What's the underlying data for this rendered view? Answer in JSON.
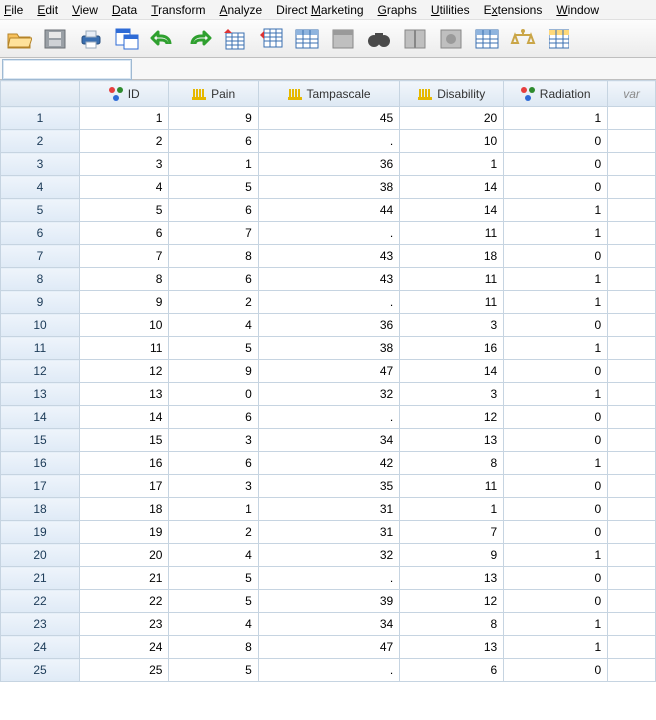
{
  "menu": {
    "file": "File",
    "edit": "Edit",
    "view": "View",
    "data": "Data",
    "transform": "Transform",
    "analyze": "Analyze",
    "direct_marketing": "Direct Marketing",
    "graphs": "Graphs",
    "utilities": "Utilities",
    "extensions": "Extensions",
    "window": "Window"
  },
  "toolbar_icons": [
    "open",
    "save",
    "print",
    "recall-dialog",
    "undo",
    "redo",
    "goto-case",
    "variables",
    "insert-cases",
    "find",
    "binoculars",
    "split-file",
    "weight-cases",
    "select-cases",
    "value-labels",
    "use-sets"
  ],
  "columns": [
    {
      "name": "ID",
      "type": "nominal"
    },
    {
      "name": "Pain",
      "type": "scale"
    },
    {
      "name": "Tampascale",
      "type": "scale"
    },
    {
      "name": "Disability",
      "type": "scale"
    },
    {
      "name": "Radiation",
      "type": "nominal"
    }
  ],
  "empty_col_label": "var",
  "rows": [
    {
      "n": 1,
      "ID": 1,
      "Pain": 9,
      "Tampascale": 45,
      "Disability": 20,
      "Radiation": 1
    },
    {
      "n": 2,
      "ID": 2,
      "Pain": 6,
      "Tampascale": ".",
      "Disability": 10,
      "Radiation": 0
    },
    {
      "n": 3,
      "ID": 3,
      "Pain": 1,
      "Tampascale": 36,
      "Disability": 1,
      "Radiation": 0
    },
    {
      "n": 4,
      "ID": 4,
      "Pain": 5,
      "Tampascale": 38,
      "Disability": 14,
      "Radiation": 0
    },
    {
      "n": 5,
      "ID": 5,
      "Pain": 6,
      "Tampascale": 44,
      "Disability": 14,
      "Radiation": 1
    },
    {
      "n": 6,
      "ID": 6,
      "Pain": 7,
      "Tampascale": ".",
      "Disability": 11,
      "Radiation": 1
    },
    {
      "n": 7,
      "ID": 7,
      "Pain": 8,
      "Tampascale": 43,
      "Disability": 18,
      "Radiation": 0
    },
    {
      "n": 8,
      "ID": 8,
      "Pain": 6,
      "Tampascale": 43,
      "Disability": 11,
      "Radiation": 1
    },
    {
      "n": 9,
      "ID": 9,
      "Pain": 2,
      "Tampascale": ".",
      "Disability": 11,
      "Radiation": 1
    },
    {
      "n": 10,
      "ID": 10,
      "Pain": 4,
      "Tampascale": 36,
      "Disability": 3,
      "Radiation": 0
    },
    {
      "n": 11,
      "ID": 11,
      "Pain": 5,
      "Tampascale": 38,
      "Disability": 16,
      "Radiation": 1
    },
    {
      "n": 12,
      "ID": 12,
      "Pain": 9,
      "Tampascale": 47,
      "Disability": 14,
      "Radiation": 0
    },
    {
      "n": 13,
      "ID": 13,
      "Pain": 0,
      "Tampascale": 32,
      "Disability": 3,
      "Radiation": 1
    },
    {
      "n": 14,
      "ID": 14,
      "Pain": 6,
      "Tampascale": ".",
      "Disability": 12,
      "Radiation": 0
    },
    {
      "n": 15,
      "ID": 15,
      "Pain": 3,
      "Tampascale": 34,
      "Disability": 13,
      "Radiation": 0
    },
    {
      "n": 16,
      "ID": 16,
      "Pain": 6,
      "Tampascale": 42,
      "Disability": 8,
      "Radiation": 1
    },
    {
      "n": 17,
      "ID": 17,
      "Pain": 3,
      "Tampascale": 35,
      "Disability": 11,
      "Radiation": 0
    },
    {
      "n": 18,
      "ID": 18,
      "Pain": 1,
      "Tampascale": 31,
      "Disability": 1,
      "Radiation": 0
    },
    {
      "n": 19,
      "ID": 19,
      "Pain": 2,
      "Tampascale": 31,
      "Disability": 7,
      "Radiation": 0
    },
    {
      "n": 20,
      "ID": 20,
      "Pain": 4,
      "Tampascale": 32,
      "Disability": 9,
      "Radiation": 1
    },
    {
      "n": 21,
      "ID": 21,
      "Pain": 5,
      "Tampascale": ".",
      "Disability": 13,
      "Radiation": 0
    },
    {
      "n": 22,
      "ID": 22,
      "Pain": 5,
      "Tampascale": 39,
      "Disability": 12,
      "Radiation": 0
    },
    {
      "n": 23,
      "ID": 23,
      "Pain": 4,
      "Tampascale": 34,
      "Disability": 8,
      "Radiation": 1
    },
    {
      "n": 24,
      "ID": 24,
      "Pain": 8,
      "Tampascale": 47,
      "Disability": 13,
      "Radiation": 1
    },
    {
      "n": 25,
      "ID": 25,
      "Pain": 5,
      "Tampascale": ".",
      "Disability": 6,
      "Radiation": 0
    }
  ]
}
